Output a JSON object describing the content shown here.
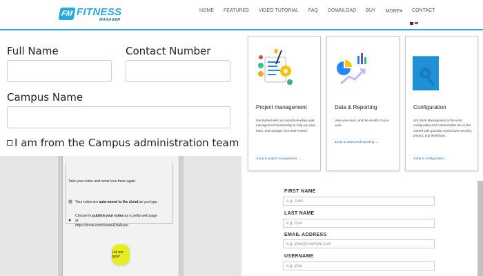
{
  "header": {
    "logo": {
      "badge": "FM",
      "main": "FITNESS",
      "sub": "MANAGER"
    },
    "nav": [
      {
        "label": "HOME"
      },
      {
        "label": "FEATURES"
      },
      {
        "label": "VIDEO TUTORIAL"
      },
      {
        "label": "FAQ"
      },
      {
        "label": "DOWNLOAD"
      },
      {
        "label": "BUY"
      },
      {
        "label": "MORE▾"
      },
      {
        "label": "CONTACT"
      }
    ]
  },
  "left_form": {
    "full_name_label": "Full Name",
    "contact_number_label": "Contact Number",
    "campus_name_label": "Campus Name",
    "checkbox_label": "I am from the Campus administration team"
  },
  "notes": {
    "intro": "Take your notes and never lose them again.",
    "point1_pre": "Your notes are ",
    "point1_bold": "auto-saved to the cloud",
    "point1_post": " as you type.",
    "point2_pre": "Choose to ",
    "point2_bold": "publish your notes",
    "point2_post": " as a pretty web page at",
    "point2_url": "https://dnote.com/#eam4DNAnyre",
    "button_label": "Let me type!"
  },
  "cards": [
    {
      "title": "Project management",
      "desc": "Get started with our industry-leading work management functionality to help you plan, track, and manage your team's work.",
      "link": "Jump to project management →",
      "icon": "project-management-icon"
    },
    {
      "title": "Data & Reporting",
      "desc": "View your work, and the results of your work",
      "link": "Jump to views and reporting →",
      "icon": "data-reporting-icon"
    },
    {
      "title": "Configuration",
      "desc": "Jira Work Management is the most configurable and customizable tool in the market with granular control over security, privacy, and workflows.",
      "link": "Jump to configuration →",
      "icon": "configuration-icon"
    }
  ],
  "right_form": {
    "first_name": {
      "label": "FIRST NAME",
      "placeholder": "e.g. John"
    },
    "last_name": {
      "label": "LAST NAME",
      "placeholder": "e.g. Doe"
    },
    "email": {
      "label": "EMAIL ADDRESS",
      "placeholder": "e.g. jdoe@example.com"
    },
    "username": {
      "label": "USERNAME",
      "placeholder": "e.g. jdoe"
    }
  },
  "colors": {
    "accent": "#2b9fd8",
    "button_yellow": "#e8ed23",
    "link": "#2a6ab8"
  }
}
